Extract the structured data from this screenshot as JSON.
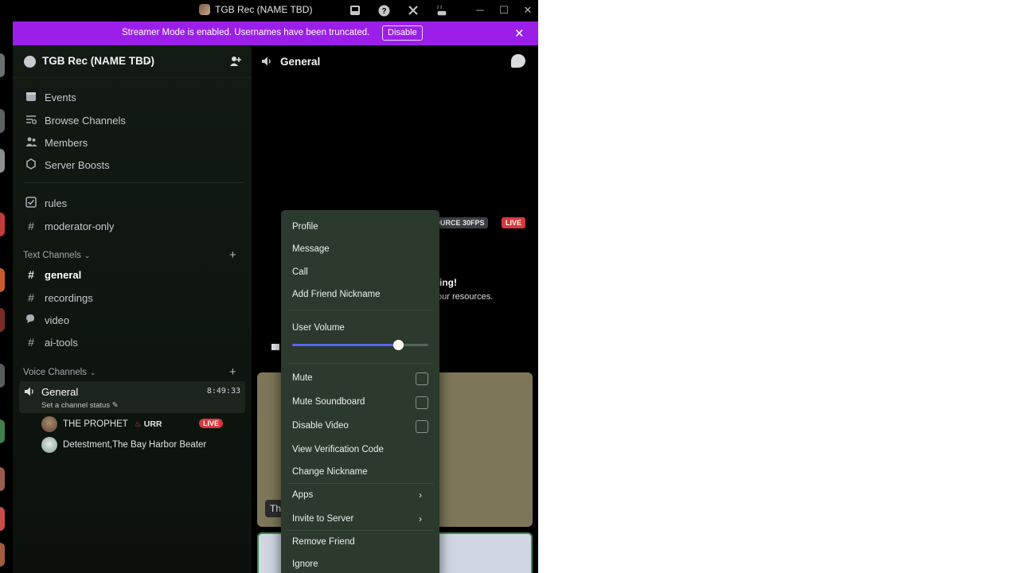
{
  "window": {
    "title": "TGB Rec (NAME TBD)",
    "controls": {
      "minimize": "─",
      "maximize": "☐",
      "close": "✕"
    }
  },
  "toolbar_icons": [
    "inbox-icon",
    "help-icon",
    "devtools-icon",
    "sleep-icon"
  ],
  "banner": {
    "message": "Streamer Mode is enabled. Usernames have been truncated.",
    "disable_label": "Disable",
    "color": "#9b1fe8"
  },
  "server": {
    "name": "TGB Rec (NAME TBD)",
    "nav": [
      {
        "label": "Events",
        "icon": "calendar-icon"
      },
      {
        "label": "Browse Channels",
        "icon": "browse-icon"
      },
      {
        "label": "Members",
        "icon": "members-icon"
      },
      {
        "label": "Server Boosts",
        "icon": "boost-icon"
      }
    ],
    "top_channels": [
      {
        "label": "rules",
        "icon": "rules-icon"
      },
      {
        "label": "moderator-only",
        "icon": "hash-icon"
      }
    ],
    "text_category": "Text Channels",
    "text_channels": [
      {
        "label": "general",
        "active": true
      },
      {
        "label": "recordings"
      },
      {
        "label": "video"
      },
      {
        "label": "ai-tools"
      }
    ],
    "voice_category": "Voice Channels",
    "voice_channel": {
      "name": "General",
      "timer": "8:49:33",
      "status": "Set a channel status",
      "members": [
        {
          "name": "THE PROPHET",
          "tag": "URR",
          "badge": "LIVE"
        },
        {
          "name": "Detestment,The Bay Harbor Beater"
        }
      ]
    }
  },
  "main": {
    "channel_name": "General",
    "source_tag": "OURCE 30FPS",
    "live_tag": "LIVE",
    "stream_msg1": "ing!",
    "stream_msg2": "our resources.",
    "tile_name_fragment": "Th"
  },
  "context_menu": {
    "items_top": [
      "Profile",
      "Message",
      "Call",
      "Add Friend Nickname"
    ],
    "volume_label": "User Volume",
    "volume_level": 0.78,
    "toggles": [
      "Mute",
      "Mute Soundboard",
      "Disable Video"
    ],
    "items_mid": [
      "View Verification Code",
      "Change Nickname"
    ],
    "submenus": [
      "Apps",
      "Invite to Server"
    ],
    "items_bottom": [
      "Remove Friend",
      "Ignore"
    ]
  },
  "colors": {
    "live": "#da373c",
    "accent": "#5865f2",
    "menu_bg": "#2b3a2c"
  }
}
